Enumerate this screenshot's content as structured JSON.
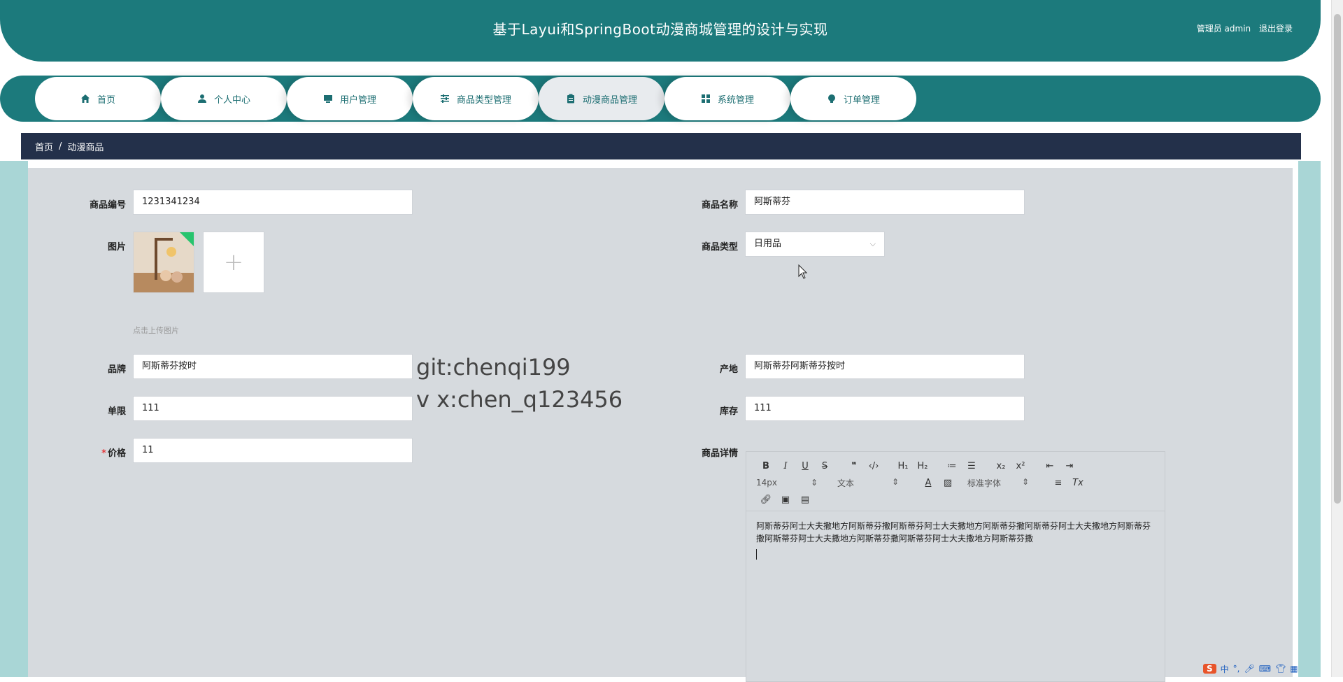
{
  "header": {
    "title": "基于Layui和SpringBoot动漫商城管理的设计与实现",
    "role_user": "管理员 admin",
    "logout": "退出登录"
  },
  "nav": {
    "items": [
      {
        "label": "首页",
        "icon": "home-icon"
      },
      {
        "label": "个人中心",
        "icon": "user-icon"
      },
      {
        "label": "用户管理",
        "icon": "monitor-icon"
      },
      {
        "label": "商品类型管理",
        "icon": "sliders-icon"
      },
      {
        "label": "动漫商品管理",
        "icon": "clipboard-icon",
        "active": true
      },
      {
        "label": "系统管理",
        "icon": "grid-icon"
      },
      {
        "label": "订单管理",
        "icon": "bulb-icon"
      }
    ]
  },
  "breadcrumb": {
    "home": "首页",
    "sep": "/",
    "current": "动漫商品"
  },
  "form": {
    "code_label": "商品编号",
    "code_value": "1231341234",
    "name_label": "商品名称",
    "name_value": "阿斯蒂芬",
    "image_label": "图片",
    "upload_hint": "点击上传图片",
    "type_label": "商品类型",
    "type_value": "日用品",
    "brand_label": "品牌",
    "brand_value": "阿斯蒂芬按时",
    "origin_label": "产地",
    "origin_value": "阿斯蒂芬阿斯蒂芬按时",
    "limit_label": "单限",
    "limit_value": "111",
    "stock_label": "库存",
    "stock_value": "111",
    "price_required": "*",
    "price_label": "价格",
    "price_value": "11",
    "detail_label": "商品详情"
  },
  "editor": {
    "font_size": "14px",
    "block_type": "文本",
    "font_family": "标准字体",
    "content": "阿斯蒂芬阿士大夫撒地方阿斯蒂芬撒阿斯蒂芬阿士大夫撒地方阿斯蒂芬撒阿斯蒂芬阿士大夫撒地方阿斯蒂芬撒阿斯蒂芬阿士大夫撒地方阿斯蒂芬撒阿斯蒂芬阿士大夫撒地方阿斯蒂芬撒"
  },
  "watermark": {
    "line1": "git:chenqi199",
    "line2": "v x:chen_q123456"
  },
  "tray": {
    "ime": "中"
  },
  "colors": {
    "primary": "#1c7a7c",
    "breadcrumb": "#23304a",
    "content_bg": "#d6dade"
  }
}
